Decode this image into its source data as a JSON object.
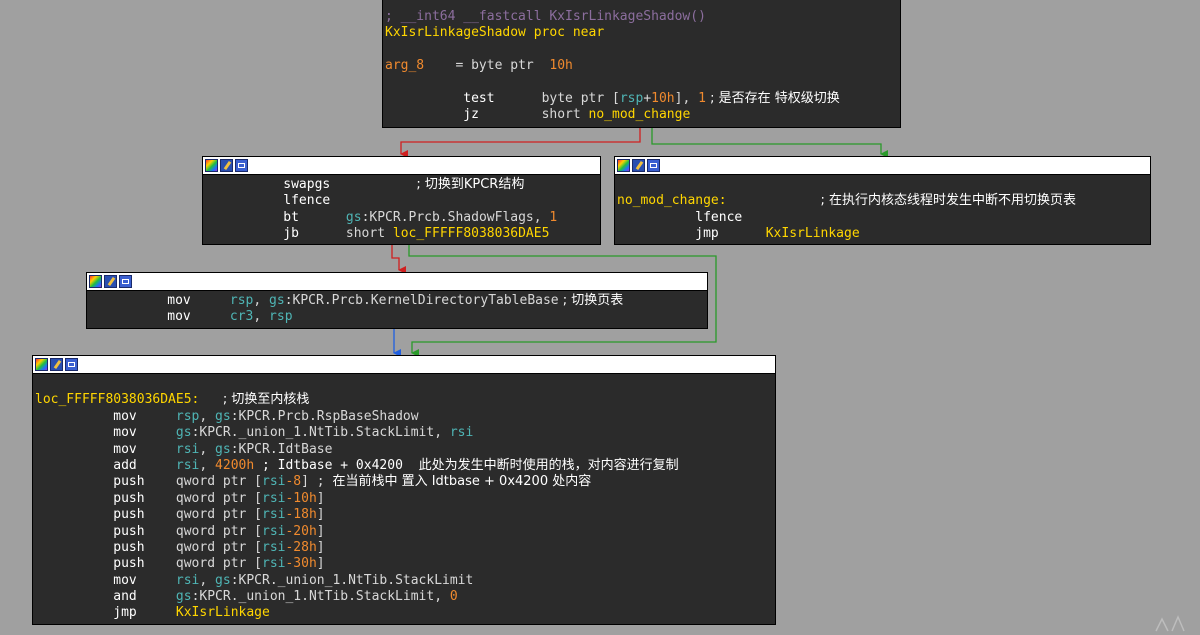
{
  "colors": {
    "background": "#a0a0a0",
    "node_bg": "#2b2b2b",
    "edge_true": "#2a9a2a",
    "edge_false": "#d02020",
    "edge_uncond": "#2060e0",
    "comment": "#8c6e9e",
    "label": "#ffd600",
    "register": "#4fb5b5",
    "number": "#f08a2e"
  },
  "node_header_icons": [
    "palette-icon",
    "edit-icon",
    "graph-icon"
  ],
  "node1": {
    "l1": "; __int64 __fastcall KxIsrLinkageShadow()",
    "l2": "KxIsrLinkageShadow proc near",
    "l4a": "arg_8",
    "l4b": "= byte ptr",
    "l4c": "10h",
    "l5_ins": "test",
    "l5a": "byte ptr [",
    "l5b": "rsp",
    "l5c": "+",
    "l5d": "10h",
    "l5e": "], ",
    "l5f": "1",
    "l5g": " ; 是否存在 特权级切换",
    "l6_ins": "jz",
    "l6a": "short ",
    "l6b": "no_mod_change"
  },
  "node2": {
    "l1_ins": "swapgs",
    "l1_cm": "; 切换到KPCR结构",
    "l2_ins": "lfence",
    "l3_ins": "bt",
    "l3a": "gs",
    "l3b": ":KPCR.Prcb.ShadowFlags, ",
    "l3c": "1",
    "l4_ins": "jb",
    "l4a": "short ",
    "l4b": "loc_FFFFF8038036DAE5"
  },
  "node3": {
    "l2a": "no_mod_change:",
    "l2b": "; 在执行内核态线程时发生中断不用切换页表",
    "l3_ins": "lfence",
    "l4_ins": "jmp",
    "l4a": "KxIsrLinkage"
  },
  "node4": {
    "l1_ins": "mov",
    "l1a": "rsp",
    "l1b": ", ",
    "l1c": "gs",
    "l1d": ":KPCR.Prcb.KernelDirectoryTableBase",
    "l1e": " ; 切换页表",
    "l2_ins": "mov",
    "l2a": "cr3",
    "l2b": ", ",
    "l2c": "rsp"
  },
  "node5": {
    "label": "loc_FFFFF8038036DAE5:",
    "label_cm": "; 切换至内核栈",
    "lines": [
      {
        "ins": "mov",
        "a": "rsp",
        "b": ", ",
        "c": "gs",
        "d": ":KPCR.Prcb.RspBaseShadow",
        "e": "",
        "f": ""
      },
      {
        "ins": "mov",
        "a": "gs",
        "b": ":KPCR._union_1.NtTib.StackLimit, ",
        "c": "rsi",
        "d": "",
        "e": "",
        "f": ""
      },
      {
        "ins": "mov",
        "a": "rsi",
        "b": ", ",
        "c": "gs",
        "d": ":KPCR.IdtBase",
        "e": "",
        "f": ""
      },
      {
        "ins": "add",
        "a": "rsi",
        "b": ", ",
        "c": "4200h",
        "d": " ; Idtbase + 0x4200  ",
        "e": "此处为发生中断时使用的栈，对内容进行复制",
        "f": ""
      },
      {
        "ins": "push",
        "a": "qword ptr [",
        "b": "rsi",
        "c": "-8",
        "d": "] ; ",
        "e": "在当前栈中 置入 Idtbase + 0x4200 处内容",
        "f": ""
      },
      {
        "ins": "push",
        "a": "qword ptr [",
        "b": "rsi",
        "c": "-10h",
        "d": "]",
        "e": "",
        "f": ""
      },
      {
        "ins": "push",
        "a": "qword ptr [",
        "b": "rsi",
        "c": "-18h",
        "d": "]",
        "e": "",
        "f": ""
      },
      {
        "ins": "push",
        "a": "qword ptr [",
        "b": "rsi",
        "c": "-20h",
        "d": "]",
        "e": "",
        "f": ""
      },
      {
        "ins": "push",
        "a": "qword ptr [",
        "b": "rsi",
        "c": "-28h",
        "d": "]",
        "e": "",
        "f": ""
      },
      {
        "ins": "push",
        "a": "qword ptr [",
        "b": "rsi",
        "c": "-30h",
        "d": "]",
        "e": "",
        "f": ""
      },
      {
        "ins": "mov",
        "a": "rsi",
        "b": ", ",
        "c": "gs",
        "d": ":KPCR._union_1.NtTib.StackLimit",
        "e": "",
        "f": ""
      },
      {
        "ins": "and",
        "a": "gs",
        "b": ":KPCR._union_1.NtTib.StackLimit, ",
        "c": "0",
        "d": "",
        "e": "",
        "f": ""
      },
      {
        "ins": "jmp",
        "a": "KxIsrLinkage",
        "b": "",
        "c": "",
        "d": "",
        "e": "",
        "f": ""
      }
    ]
  }
}
